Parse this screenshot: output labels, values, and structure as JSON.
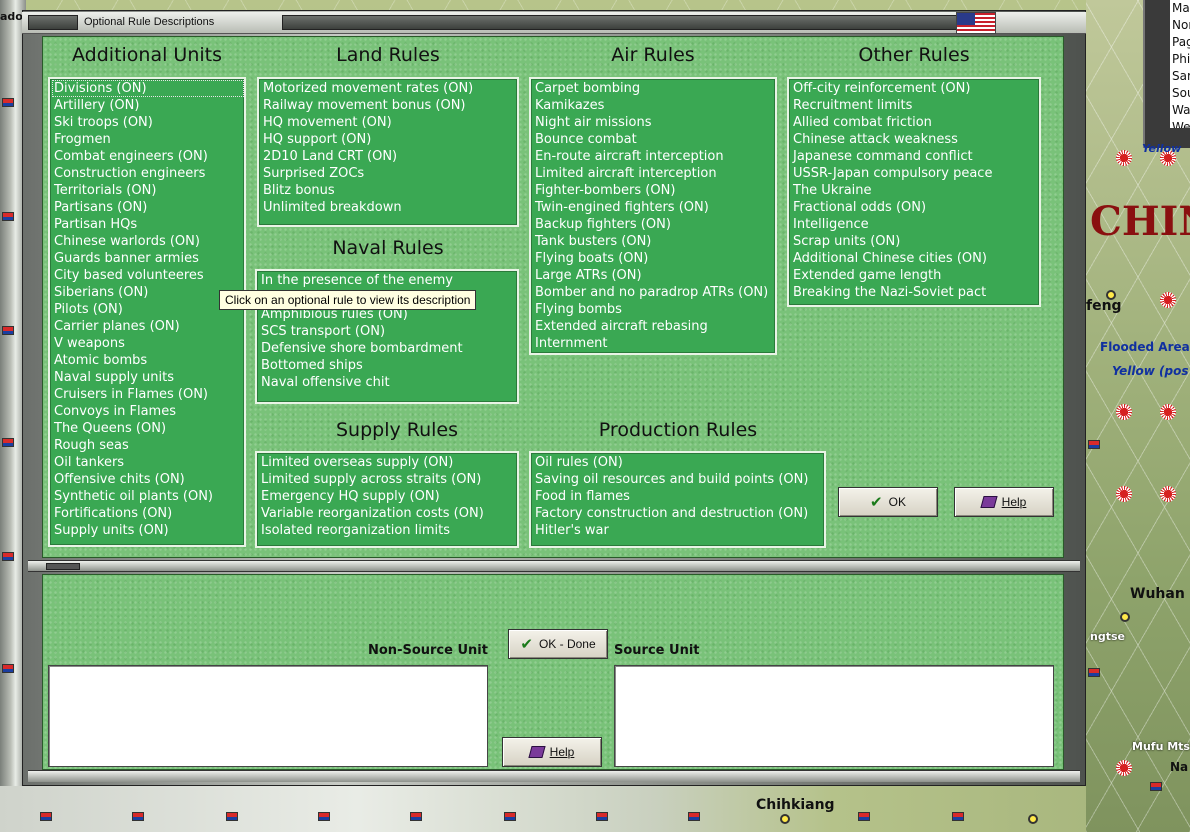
{
  "window": {
    "title": "Optional Rule Descriptions"
  },
  "tooltip": "Click on an optional rule to view its description",
  "sections": {
    "additional_units": {
      "heading": "Additional Units",
      "items": [
        "Divisions (ON)",
        "Artillery (ON)",
        "Ski troops (ON)",
        "Frogmen",
        "Combat engineers (ON)",
        "Construction engineers",
        "Territorials (ON)",
        "Partisans (ON)",
        "Partisan HQs",
        "Chinese warlords (ON)",
        "Guards banner armies",
        "City based volunteeres",
        "Siberians (ON)",
        "Pilots (ON)",
        "Carrier planes (ON)",
        "V weapons",
        "Atomic bombs",
        "Naval supply units",
        "Cruisers in Flames (ON)",
        "Convoys in Flames",
        "The Queens (ON)",
        "Rough seas",
        "Oil tankers",
        "Offensive chits (ON)",
        "Synthetic oil plants (ON)",
        "Fortifications (ON)",
        "Supply units (ON)"
      ]
    },
    "land_rules": {
      "heading": "Land Rules",
      "items": [
        "Motorized movement rates (ON)",
        "Railway movement bonus (ON)",
        "HQ movement (ON)",
        "HQ support (ON)",
        "2D10 Land CRT (ON)",
        "Surprised ZOCs",
        "Blitz bonus",
        "Unlimited breakdown"
      ]
    },
    "naval_rules": {
      "heading": "Naval Rules",
      "items": [
        "In the presence of the enemy",
        "",
        "Amphibious rules (ON)",
        "SCS transport (ON)",
        "Defensive shore bombardment",
        "Bottomed ships",
        "Naval offensive chit"
      ]
    },
    "air_rules": {
      "heading": "Air Rules",
      "items": [
        "Carpet bombing",
        "Kamikazes",
        "Night air missions",
        "Bounce combat",
        "En-route aircraft interception",
        "Limited aircraft interception",
        "Fighter-bombers (ON)",
        "Twin-engined fighters (ON)",
        "Backup fighters (ON)",
        "Tank busters (ON)",
        "Flying boats (ON)",
        "Large ATRs (ON)",
        "Bomber and no paradrop ATRs (ON)",
        "Flying bombs",
        "Extended aircraft rebasing",
        "Internment"
      ]
    },
    "other_rules": {
      "heading": "Other Rules",
      "items": [
        "Off-city reinforcement (ON)",
        "Recruitment limits",
        "Allied combat friction",
        "Chinese attack weakness",
        "Japanese command conflict",
        "USSR-Japan compulsory peace",
        "The Ukraine",
        "Fractional odds (ON)",
        "Intelligence",
        "Scrap units (ON)",
        "Additional Chinese cities (ON)",
        "Extended game length",
        "Breaking the Nazi-Soviet pact"
      ]
    },
    "supply_rules": {
      "heading": "Supply Rules",
      "items": [
        "Limited overseas supply (ON)",
        "Limited supply across straits (ON)",
        "Emergency HQ supply (ON)",
        "Variable reorganization costs (ON)",
        "Isolated reorganization limits"
      ]
    },
    "production_rules": {
      "heading": "Production Rules",
      "items": [
        "Oil rules (ON)",
        "Saving oil resources and build points (ON)",
        "Food in flames",
        "Factory construction and destruction (ON)",
        "Hitler's war"
      ]
    }
  },
  "buttons": {
    "ok": "OK",
    "help": "Help",
    "ok_done": "OK - Done",
    "help_bottom": "Help"
  },
  "bottom": {
    "non_source_label": "Non-Source Unit",
    "source_label": "Source Unit"
  },
  "map": {
    "labels": {
      "china": "CHIN",
      "feng": "feng",
      "flooded": "Flooded Area",
      "yellow_pos": "Yellow (pos",
      "yellow": "Yellow",
      "wuhan": "Wuhan",
      "ngtse": "ngtse",
      "mufu": "Mufu Mts",
      "chihkiang": "Chihkiang",
      "na": "Na",
      "ado": "ado"
    },
    "panel_items": [
      "Ma",
      "Nor",
      "Pag",
      "Phi",
      "Sar",
      "Sou",
      "Wa",
      "We"
    ]
  },
  "colors": {
    "panel_green": "#79c279",
    "list_green": "#3aa853",
    "tooltip_bg": "#ffffe1"
  }
}
